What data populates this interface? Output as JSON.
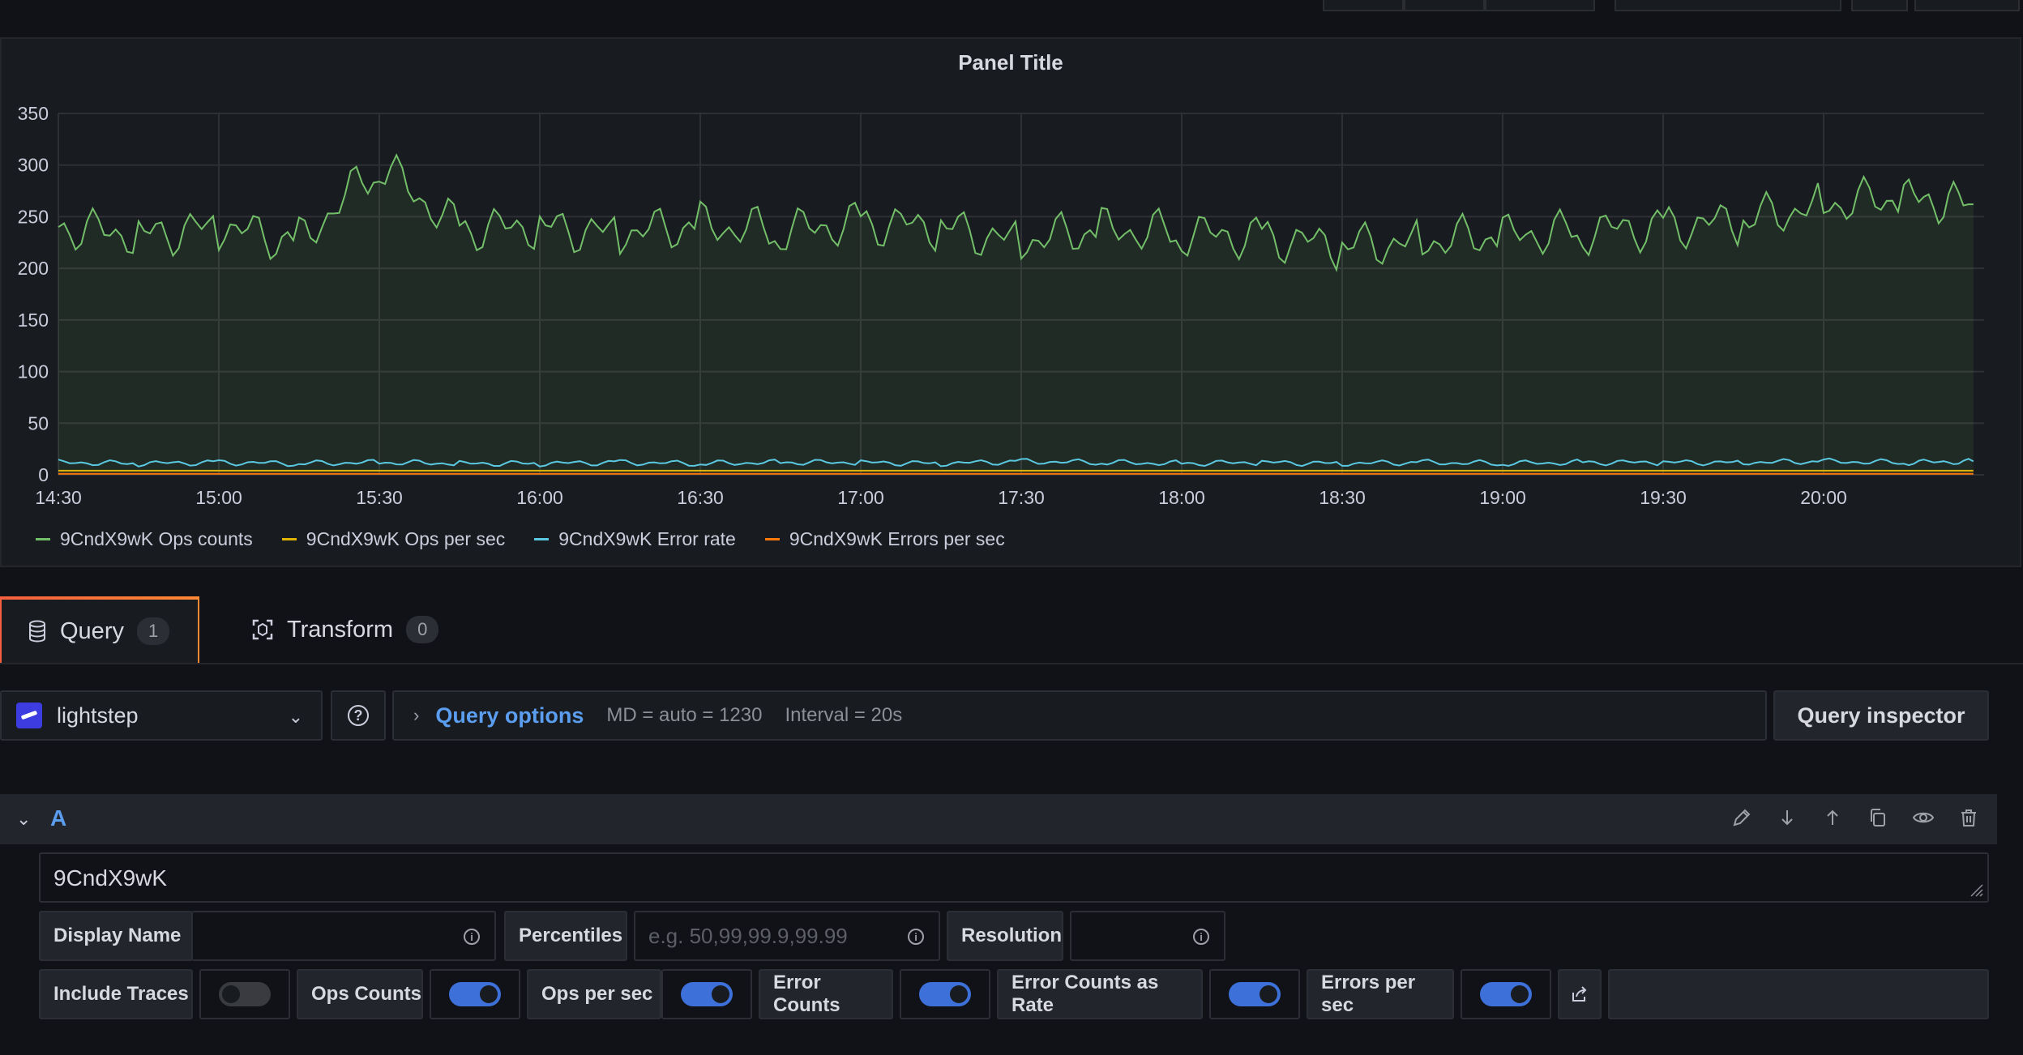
{
  "panel": {
    "title": "Panel Title"
  },
  "chart_data": {
    "type": "line",
    "title": "Panel Title",
    "x_ticks": [
      "14:30",
      "15:00",
      "15:30",
      "16:00",
      "16:30",
      "17:00",
      "17:30",
      "18:00",
      "18:30",
      "19:00",
      "19:30",
      "20:00"
    ],
    "y_ticks": [
      0,
      50,
      100,
      150,
      200,
      250,
      300,
      350
    ],
    "ylim": [
      0,
      350
    ],
    "xlim": [
      "14:30",
      "20:30"
    ],
    "grid": true,
    "legend_position": "bottom-left",
    "series": [
      {
        "name": "9CndX9wK Ops counts",
        "color": "#73bf69",
        "x": [
          "14:30",
          "14:45",
          "15:00",
          "15:15",
          "15:30",
          "15:45",
          "16:00",
          "16:15",
          "16:30",
          "16:45",
          "17:00",
          "17:15",
          "17:30",
          "17:45",
          "18:00",
          "18:15",
          "18:30",
          "18:45",
          "19:00",
          "19:15",
          "19:30",
          "19:45",
          "20:00",
          "20:15",
          "20:28"
        ],
        "values": [
          240,
          232,
          240,
          226,
          300,
          238,
          240,
          234,
          242,
          236,
          244,
          240,
          226,
          238,
          234,
          230,
          222,
          226,
          232,
          236,
          240,
          246,
          262,
          268,
          262
        ]
      },
      {
        "name": "9CndX9wK Ops per sec",
        "color": "#e0b400",
        "x": [
          "14:30",
          "17:30",
          "20:28"
        ],
        "values": [
          4,
          4,
          4
        ]
      },
      {
        "name": "9CndX9wK Error rate",
        "color": "#5ac8e0",
        "x": [
          "14:30",
          "14:45",
          "15:00",
          "15:15",
          "15:30",
          "15:45",
          "16:00",
          "16:15",
          "16:30",
          "16:45",
          "17:00",
          "17:15",
          "17:30",
          "17:45",
          "18:00",
          "18:15",
          "18:30",
          "18:45",
          "19:00",
          "19:15",
          "19:30",
          "19:45",
          "20:00",
          "20:15",
          "20:28"
        ],
        "values": [
          12,
          11,
          12,
          11,
          12,
          11,
          11,
          12,
          11,
          12,
          12,
          11,
          13,
          12,
          11,
          12,
          11,
          12,
          11,
          12,
          12,
          12,
          13,
          12,
          13
        ]
      },
      {
        "name": "9CndX9wK Errors per sec",
        "color": "#ff780a",
        "x": [
          "14:30",
          "17:30",
          "20:28"
        ],
        "values": [
          1,
          1,
          1
        ]
      }
    ]
  },
  "tabs": [
    {
      "label": "Query",
      "count": "1"
    },
    {
      "label": "Transform",
      "count": "0"
    }
  ],
  "datasource": {
    "name": "lightstep"
  },
  "query_options": {
    "label": "Query options",
    "md": "MD = auto = 1230",
    "interval": "Interval = 20s"
  },
  "query_inspector": {
    "label": "Query inspector"
  },
  "query": {
    "letter": "A",
    "text": "9CndX9wK",
    "display_name_label": "Display Name",
    "display_name_value": "",
    "percentiles_label": "Percentiles",
    "percentiles_placeholder": "e.g. 50,99,99.9,99.99",
    "resolution_label": "Resolution",
    "resolution_value": "",
    "toggles": [
      {
        "label": "Include Traces",
        "on": false
      },
      {
        "label": "Ops Counts",
        "on": true
      },
      {
        "label": "Ops per sec",
        "on": true
      },
      {
        "label": "Error Counts",
        "on": true
      },
      {
        "label": "Error Counts as Rate",
        "on": true
      },
      {
        "label": "Errors per sec",
        "on": true
      }
    ]
  }
}
